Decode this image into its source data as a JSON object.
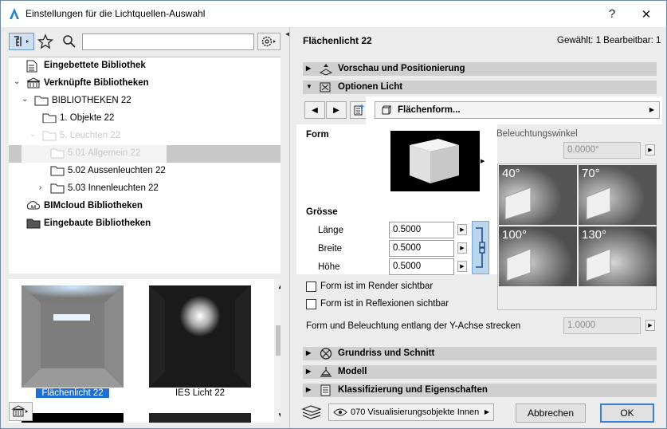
{
  "window": {
    "title": "Einstellungen für die Lichtquellen-Auswahl",
    "help_label": "?",
    "close_label": "✕"
  },
  "tree": {
    "items": [
      {
        "label": "Eingebettete Bibliothek"
      },
      {
        "label": "Verknüpfte Bibliotheken"
      },
      {
        "label": "BIBLIOTHEKEN 22"
      },
      {
        "label": "1. Objekte 22"
      },
      {
        "label": "5. Leuchten 22"
      },
      {
        "label": "5.01 Allgemein 22"
      },
      {
        "label": "5.02 Aussenleuchten 22"
      },
      {
        "label": "5.03 Innenleuchten 22"
      },
      {
        "label": "BIMcloud Bibliotheken"
      },
      {
        "label": "Eingebaute Bibliotheken"
      }
    ]
  },
  "thumbnails": [
    {
      "label": "Flächenlicht 22"
    },
    {
      "label": "IES Licht 22"
    }
  ],
  "panel": {
    "title": "Flächenlicht 22",
    "selection_info": "Gewählt: 1 Bearbeitbar: 1",
    "sections": {
      "vorschau": "Vorschau und Positionierung",
      "optionen": "Optionen Licht",
      "grundriss": "Grundriss und Schnitt",
      "modell": "Modell",
      "klassifizierung": "Klassifizierung und Eigenschaften"
    },
    "page_dropdown": "Flächenform...",
    "form_label": "Form",
    "groesse_label": "Grösse",
    "fields": [
      {
        "label": "Länge",
        "value": "0.5000"
      },
      {
        "label": "Breite",
        "value": "0.5000"
      },
      {
        "label": "Höhe",
        "value": "0.5000"
      }
    ],
    "beleuchtungswinkel_label": "Beleuchtungswinkel",
    "beleuchtungswinkel_value": "0.0000°",
    "angles": [
      "40°",
      "70°",
      "100°",
      "130°"
    ],
    "check_render": "Form ist im Render sichtbar",
    "check_reflex": "Form ist in Reflexionen sichtbar",
    "stretch_label": "Form und Beleuchtung entlang der Y-Achse strecken",
    "stretch_value": "1.0000"
  },
  "footer": {
    "layer": "070 Visualisierungsobjekte Innen",
    "cancel": "Abbrechen",
    "ok": "OK"
  },
  "colors": {
    "accent_blue": "#3c7fd1",
    "highlight_link": "#bcd6ee",
    "selected_label_bg": "#1e6fd0"
  }
}
